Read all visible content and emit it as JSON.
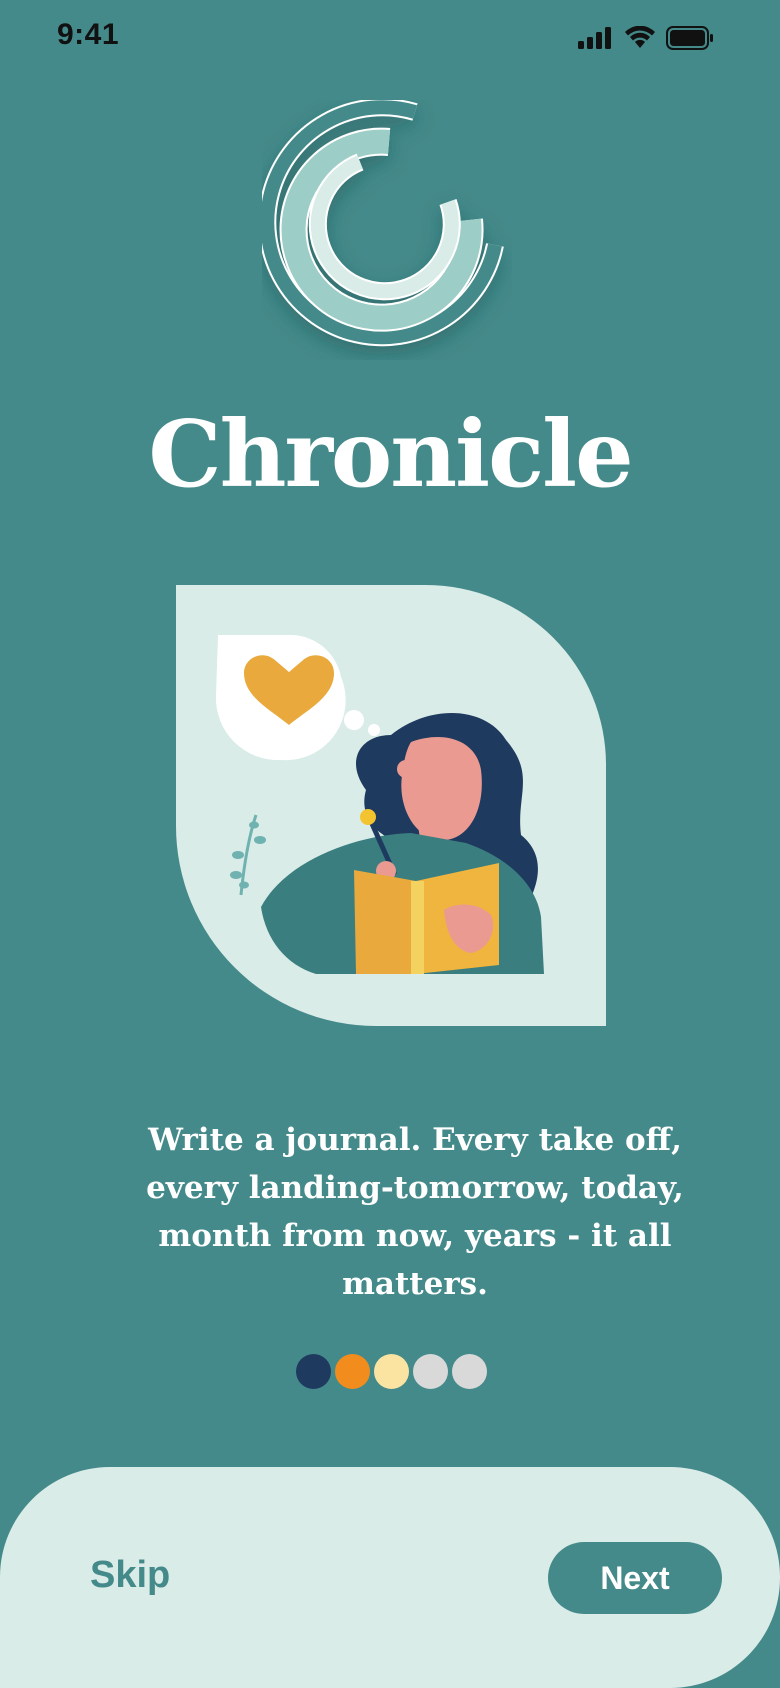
{
  "status_bar": {
    "time": "9:41"
  },
  "app": {
    "title": "Chronicle"
  },
  "onboarding": {
    "caption": "Write a journal. Every take off, every landing-tomorrow, today, month from now, years -  it all matters.",
    "page_dots": [
      {
        "color": "#1f3a5f",
        "active": true
      },
      {
        "color": "#f28c1c",
        "active": false
      },
      {
        "color": "#fbe3a2",
        "active": false
      },
      {
        "color": "#d9d9d9",
        "active": false
      },
      {
        "color": "#d9d9d9",
        "active": false
      }
    ]
  },
  "footer": {
    "skip_label": "Skip",
    "next_label": "Next"
  },
  "icons": [
    "cellular-signal-icon",
    "wifi-icon",
    "battery-icon",
    "chronicle-logo-icon",
    "heart-icon"
  ],
  "colors": {
    "background": "#458a8a",
    "panel": "#d9ece8",
    "primary": "#458a8a",
    "text": "#ffffff"
  }
}
